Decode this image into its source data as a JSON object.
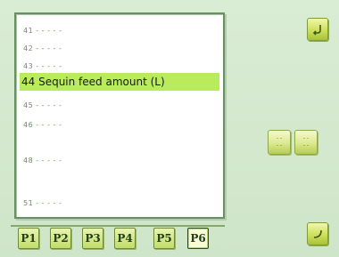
{
  "list": {
    "items": [
      {
        "label": "41 - - - - -",
        "selected": false
      },
      {
        "label": "42 - - - - -",
        "selected": false
      },
      {
        "label": "43 - - - - -",
        "selected": false
      },
      {
        "label": "44 Sequin feed amount (L)",
        "selected": true
      },
      {
        "label": "45 - - - - -",
        "selected": false
      },
      {
        "label": "46 - - - - -",
        "selected": false
      },
      {
        "label": "48 - - - - -",
        "selected": false
      },
      {
        "label": "51 - - - - -",
        "selected": false
      }
    ]
  },
  "mid_buttons": [
    {
      "line1": "- -",
      "line2": "- -"
    },
    {
      "line1": "- -",
      "line2": "- -"
    }
  ],
  "tabs": [
    {
      "label": "P1",
      "active": false
    },
    {
      "label": "P2",
      "active": false
    },
    {
      "label": "P3",
      "active": false
    },
    {
      "label": "P4",
      "active": false
    },
    {
      "label": "P5",
      "active": false
    },
    {
      "label": "P6",
      "active": true
    }
  ],
  "colors": {
    "background": "#d4e8cf",
    "selected_row": "#b9ec5c",
    "button_yellow": "#c9dd55"
  },
  "icons": {
    "top_right": "return-arrow-icon",
    "bottom_right": "enter-arrow-icon"
  }
}
